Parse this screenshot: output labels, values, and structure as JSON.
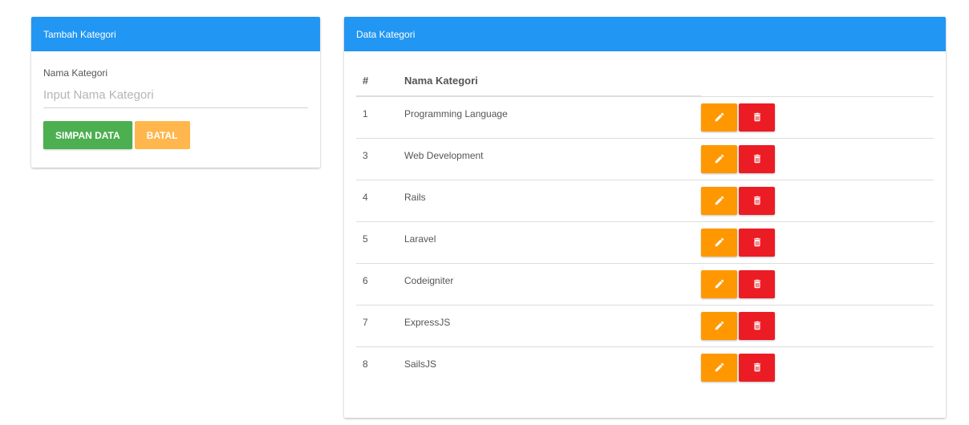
{
  "form_card": {
    "title": "Tambah Kategori",
    "label": "Nama Kategori",
    "input_placeholder": "Input Nama Kategori",
    "input_value": "",
    "save_label": "SIMPAN DATA",
    "cancel_label": "BATAL"
  },
  "table_card": {
    "title": "Data Kategori",
    "columns": [
      "#",
      "Nama Kategori",
      ""
    ],
    "rows": [
      {
        "num": "1",
        "name": "Programming Language"
      },
      {
        "num": "3",
        "name": "Web Development"
      },
      {
        "num": "4",
        "name": "Rails"
      },
      {
        "num": "5",
        "name": "Laravel"
      },
      {
        "num": "6",
        "name": "Codeigniter"
      },
      {
        "num": "7",
        "name": "ExpressJS"
      },
      {
        "num": "8",
        "name": "SailsJS"
      }
    ],
    "row_actions": [
      {
        "icon": "pencil-icon",
        "color": "#ff9800"
      },
      {
        "icon": "trash-icon",
        "color": "#ec1c24"
      }
    ]
  },
  "colors": {
    "header": "#2196f3",
    "save": "#4caf50",
    "cancel": "#ffb74d",
    "edit": "#ff9800",
    "delete": "#ec1c24"
  }
}
